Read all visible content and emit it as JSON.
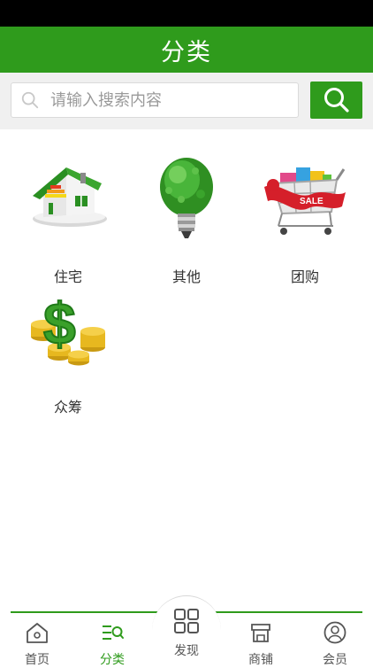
{
  "header": {
    "title": "分类"
  },
  "search": {
    "placeholder": "请输入搜索内容",
    "value": ""
  },
  "categories": [
    {
      "label": "住宅",
      "icon": "house-icon"
    },
    {
      "label": "其他",
      "icon": "lightbulb-icon"
    },
    {
      "label": "团购",
      "icon": "shopping-cart-icon"
    },
    {
      "label": "众筹",
      "icon": "dollar-coins-icon"
    }
  ],
  "tabs": [
    {
      "label": "首页",
      "icon": "home-icon"
    },
    {
      "label": "分类",
      "icon": "category-icon",
      "active": true
    },
    {
      "label": "发现",
      "icon": "grid-icon"
    },
    {
      "label": "商铺",
      "icon": "store-icon"
    },
    {
      "label": "会员",
      "icon": "user-icon"
    }
  ],
  "colors": {
    "brand": "#2f9b1c",
    "status_bar": "#000000",
    "search_bg": "#f0f0f0"
  }
}
